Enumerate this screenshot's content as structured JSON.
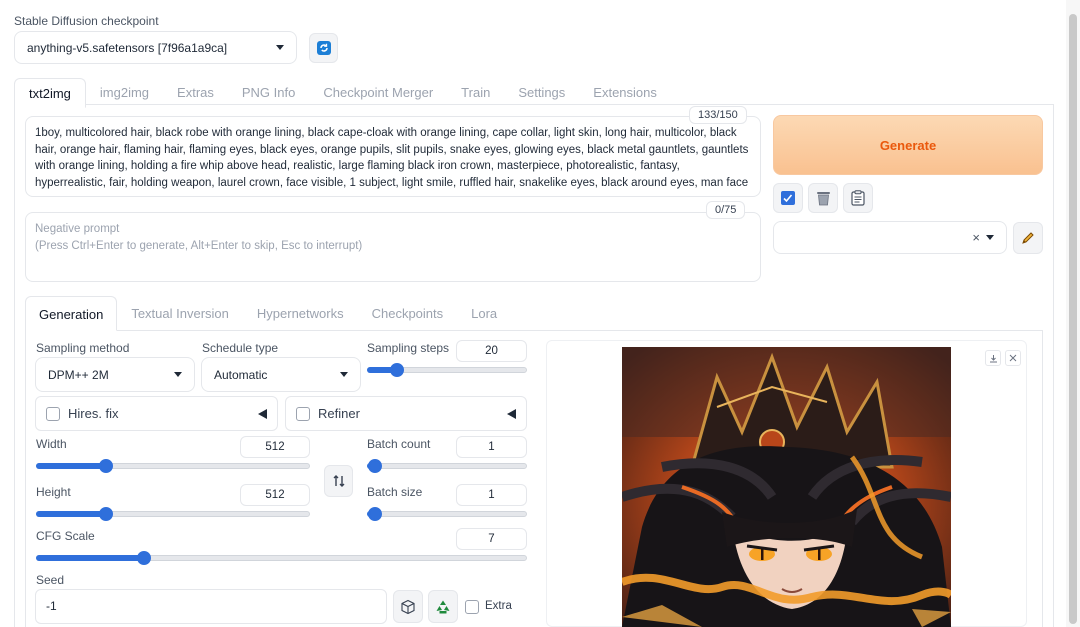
{
  "checkpoint": {
    "label": "Stable Diffusion checkpoint",
    "value": "anything-v5.safetensors [7f96a1a9ca]"
  },
  "main_tabs": [
    "txt2img",
    "img2img",
    "Extras",
    "PNG Info",
    "Checkpoint Merger",
    "Train",
    "Settings",
    "Extensions"
  ],
  "prompt": {
    "counter": "133/150",
    "text": "1boy, multicolored hair, black robe with orange lining, black cape-cloak with orange lining, cape collar, light skin, long hair, multicolor, black hair, orange hair, flaming hair, flaming eyes, black eyes, orange pupils, slit pupils, snake eyes, glowing eyes, black metal gauntlets, gauntlets with orange lining, holding a fire whip above head, realistic, large flaming black iron crown, masterpiece, photorealistic, fantasy, hyperrealistic, fair, holding weapon, laurel crown, face visible, 1 subject, light smile, ruffled hair, snakelike eyes, black around eyes, man face"
  },
  "negative_prompt": {
    "counter": "0/75",
    "placeholder_line1": "Negative prompt",
    "placeholder_line2": "(Press Ctrl+Enter to generate, Alt+Enter to skip, Esc to interrupt)"
  },
  "generate_label": "Generate",
  "sub_tabs": [
    "Generation",
    "Textual Inversion",
    "Hypernetworks",
    "Checkpoints",
    "Lora"
  ],
  "sampling_method": {
    "label": "Sampling method",
    "value": "DPM++ 2M"
  },
  "schedule_type": {
    "label": "Schedule type",
    "value": "Automatic"
  },
  "sampling_steps": {
    "label": "Sampling steps",
    "value": "20",
    "level": 0.15
  },
  "hires_fix": {
    "label": "Hires. fix"
  },
  "refiner": {
    "label": "Refiner"
  },
  "width": {
    "label": "Width",
    "value": "512",
    "level": 0.24
  },
  "height": {
    "label": "Height",
    "value": "512",
    "level": 0.24
  },
  "batch_count": {
    "label": "Batch count",
    "value": "1",
    "level": 0.0
  },
  "batch_size": {
    "label": "Batch size",
    "value": "1",
    "level": 0.0
  },
  "cfg_scale": {
    "label": "CFG Scale",
    "value": "7",
    "level": 0.21
  },
  "seed": {
    "label": "Seed",
    "value": "-1",
    "extra_label": "Extra"
  },
  "colors": {
    "accent": "#2f6fdb",
    "generate_text": "#ea580c",
    "generate_bg": "#fcd2aa"
  }
}
